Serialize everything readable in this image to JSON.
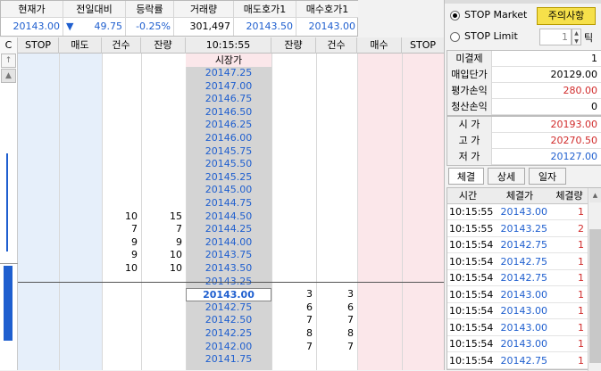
{
  "summary": {
    "labels": [
      "현재가",
      "전일대비",
      "등락률",
      "거래량",
      "매도호가1",
      "매수호가1"
    ],
    "current_price": "20143.00",
    "change_arrow": "▼",
    "change": "49.75",
    "change_rate": "-0.25%",
    "volume": "301,497",
    "ask1": "20143.50",
    "bid1": "20143.00"
  },
  "book": {
    "left_label": "C",
    "headers": [
      "STOP",
      "매도",
      "건수",
      "잔량",
      "10:15:55",
      "잔량",
      "건수",
      "매수",
      "STOP"
    ],
    "market_label": "시장가",
    "prices": [
      "20147.25",
      "20147.00",
      "20146.75",
      "20146.50",
      "20146.25",
      "20146.00",
      "20145.75",
      "20145.50",
      "20145.25",
      "20145.00",
      "20144.75",
      "20144.50",
      "20144.25",
      "20144.00",
      "20143.75",
      "20143.50",
      "20143.25",
      "20143.00",
      "20142.75",
      "20142.50",
      "20142.25",
      "20142.00",
      "20141.75"
    ],
    "ask_counts": [
      "",
      "",
      "",
      "",
      "",
      "",
      "",
      "",
      "",
      "",
      "",
      "10",
      "7",
      "9",
      "9",
      "10",
      "",
      "",
      "",
      "",
      "",
      "",
      ""
    ],
    "ask_qty": [
      "",
      "",
      "",
      "",
      "",
      "",
      "",
      "",
      "",
      "",
      "",
      "15",
      "7",
      "9",
      "10",
      "10",
      "",
      "",
      "",
      "",
      "",
      "",
      ""
    ],
    "bid_qty": [
      "",
      "",
      "",
      "",
      "",
      "",
      "",
      "",
      "",
      "",
      "",
      "",
      "",
      "",
      "",
      "",
      "",
      "3",
      "6",
      "7",
      "8",
      "7",
      ""
    ],
    "bid_counts": [
      "",
      "",
      "",
      "",
      "",
      "",
      "",
      "",
      "",
      "",
      "",
      "",
      "",
      "",
      "",
      "",
      "",
      "3",
      "6",
      "7",
      "8",
      "7",
      ""
    ]
  },
  "order": {
    "stop_market": "STOP Market",
    "stop_limit": "STOP Limit",
    "warning_button": "주의사항",
    "tick_value": "1",
    "tick_unit": "틱"
  },
  "position": [
    {
      "label": "미결제",
      "value": "1"
    },
    {
      "label": "매입단가",
      "value": "20129.00"
    },
    {
      "label": "평가손익",
      "value": "280.00"
    },
    {
      "label": "청산손익",
      "value": "0"
    }
  ],
  "prices": [
    {
      "label": "시 가",
      "value": "20193.00"
    },
    {
      "label": "고 가",
      "value": "20270.50"
    },
    {
      "label": "저 가",
      "value": "20127.00"
    }
  ],
  "tabs": [
    "체결",
    "상세",
    "일자"
  ],
  "trades": {
    "headers": [
      "시간",
      "체결가",
      "체결량"
    ],
    "rows": [
      {
        "time": "10:15:55",
        "price": "20143.00",
        "qty": "1"
      },
      {
        "time": "10:15:55",
        "price": "20143.25",
        "qty": "2"
      },
      {
        "time": "10:15:54",
        "price": "20142.75",
        "qty": "1"
      },
      {
        "time": "10:15:54",
        "price": "20142.75",
        "qty": "1"
      },
      {
        "time": "10:15:54",
        "price": "20142.75",
        "qty": "1"
      },
      {
        "time": "10:15:54",
        "price": "20143.00",
        "qty": "1"
      },
      {
        "time": "10:15:54",
        "price": "20143.00",
        "qty": "1"
      },
      {
        "time": "10:15:54",
        "price": "20143.00",
        "qty": "1"
      },
      {
        "time": "10:15:54",
        "price": "20143.00",
        "qty": "1"
      },
      {
        "time": "10:15:54",
        "price": "20142.75",
        "qty": "1"
      }
    ]
  },
  "colors": {
    "blue": "#1f5fcf",
    "red": "#d12b2b",
    "ask_bg": "#e6effa",
    "bid_bg": "#fbe7ea",
    "price_bg": "#d4d4d4"
  }
}
